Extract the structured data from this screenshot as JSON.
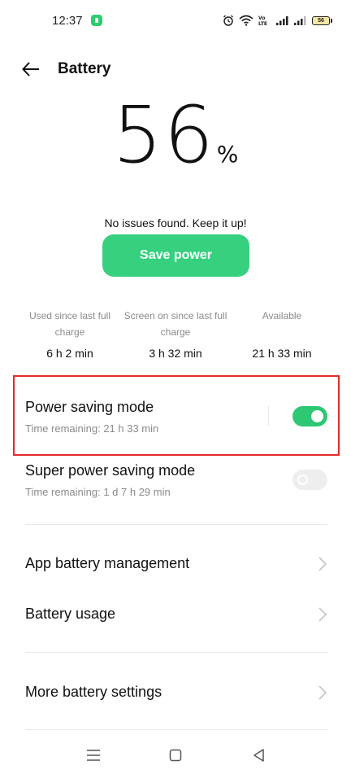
{
  "status_bar": {
    "time": "12:37",
    "battery_level": "56",
    "icons": [
      "alarm-icon",
      "wifi-icon",
      "volte-icon",
      "signal-icon",
      "signal-icon",
      "battery-icon"
    ]
  },
  "header": {
    "title": "Battery"
  },
  "battery": {
    "percent": "56",
    "percent_sign": "%",
    "message": "No issues found. Keep it up!",
    "save_power_label": "Save power"
  },
  "stats": [
    {
      "label": "Used since last full charge",
      "value": "6 h 2 min"
    },
    {
      "label": "Screen on since last full charge",
      "value": "3 h 32 min"
    },
    {
      "label": "Available",
      "value": "21 h 33 min"
    }
  ],
  "power_saving": {
    "title": "Power saving mode",
    "subtitle": "Time remaining:  21 h 33 min",
    "enabled": true
  },
  "super_power_saving": {
    "title": "Super power saving mode",
    "subtitle": "Time remaining:  1 d 7 h 29 min",
    "enabled": false
  },
  "menu": {
    "app_battery_management": "App battery management",
    "battery_usage": "Battery usage",
    "more_battery_settings": "More battery settings"
  },
  "colors": {
    "accent": "#36d07f",
    "toggle_on": "#2ec773",
    "highlight": "#e52a2a"
  },
  "nav": [
    "menu-icon",
    "home-icon",
    "back-triangle-icon"
  ]
}
